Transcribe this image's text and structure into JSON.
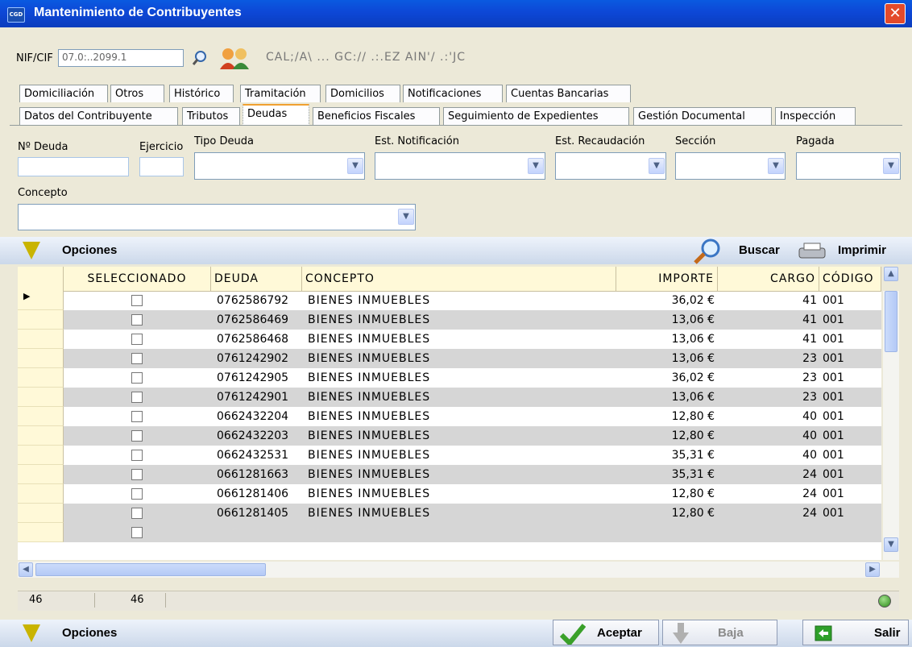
{
  "window": {
    "title": "Mantenimiento de Contribuyentes",
    "close_label": "✕",
    "app_icon_text": "CGD"
  },
  "nif": {
    "label": "NIF/CIF",
    "value": "07.0:..2099.1",
    "taxpayer_name": "CAL;/A\\ ... GC:// .:.EZ AIN'/ .:'JC"
  },
  "tabs_row1": [
    "Domiciliación",
    "Otros",
    "Histórico",
    "Tramitación",
    "Domicilios",
    "Notificaciones",
    "Cuentas Bancarias"
  ],
  "tabs_row2": [
    "Datos del Contribuyente",
    "Tributos",
    "Deudas",
    "Beneficios Fiscales",
    "Seguimiento de Expedientes",
    "Gestión Documental",
    "Inspección"
  ],
  "active_tab": "Deudas",
  "filters": {
    "n_deuda": "Nº Deuda",
    "ejercicio": "Ejercicio",
    "tipo_deuda": "Tipo Deuda",
    "est_notificacion": "Est. Notificación",
    "est_recaudacion": "Est. Recaudación",
    "seccion": "Sección",
    "pagada": "Pagada",
    "concepto": "Concepto"
  },
  "options_bar": {
    "label": "Opciones",
    "search_label": "Buscar",
    "print_label": "Imprimir"
  },
  "grid": {
    "columns": [
      "SELECCIONADO",
      "DEUDA",
      "CONCEPTO",
      "IMPORTE",
      "CARGO",
      "CÓDIGO"
    ],
    "rows": [
      {
        "deuda": "0762586792",
        "concepto": "BIENES INMUEBLES",
        "importe": "36,02 €",
        "cargo": "41",
        "codigo": "001"
      },
      {
        "deuda": "0762586469",
        "concepto": "BIENES INMUEBLES",
        "importe": "13,06 €",
        "cargo": "41",
        "codigo": "001"
      },
      {
        "deuda": "0762586468",
        "concepto": "BIENES INMUEBLES",
        "importe": "13,06 €",
        "cargo": "41",
        "codigo": "001"
      },
      {
        "deuda": "0761242902",
        "concepto": "BIENES INMUEBLES",
        "importe": "13,06 €",
        "cargo": "23",
        "codigo": "001"
      },
      {
        "deuda": "0761242905",
        "concepto": "BIENES INMUEBLES",
        "importe": "36,02 €",
        "cargo": "23",
        "codigo": "001"
      },
      {
        "deuda": "0761242901",
        "concepto": "BIENES INMUEBLES",
        "importe": "13,06 €",
        "cargo": "23",
        "codigo": "001"
      },
      {
        "deuda": "0662432204",
        "concepto": "BIENES INMUEBLES",
        "importe": "12,80 €",
        "cargo": "40",
        "codigo": "001"
      },
      {
        "deuda": "0662432203",
        "concepto": "BIENES INMUEBLES",
        "importe": "12,80 €",
        "cargo": "40",
        "codigo": "001"
      },
      {
        "deuda": "0662432531",
        "concepto": "BIENES INMUEBLES",
        "importe": "35,31 €",
        "cargo": "40",
        "codigo": "001"
      },
      {
        "deuda": "0661281663",
        "concepto": "BIENES INMUEBLES",
        "importe": "35,31 €",
        "cargo": "24",
        "codigo": "001"
      },
      {
        "deuda": "0661281406",
        "concepto": "BIENES INMUEBLES",
        "importe": "12,80 €",
        "cargo": "24",
        "codigo": "001"
      },
      {
        "deuda": "0661281405",
        "concepto": "BIENES INMUEBLES",
        "importe": "12,80 €",
        "cargo": "24",
        "codigo": "001"
      }
    ]
  },
  "status": {
    "count1": "46",
    "count2": "46"
  },
  "footer": {
    "options_label": "Opciones",
    "aceptar_label": "Aceptar",
    "baja_label": "Baja",
    "salir_label": "Salir"
  }
}
